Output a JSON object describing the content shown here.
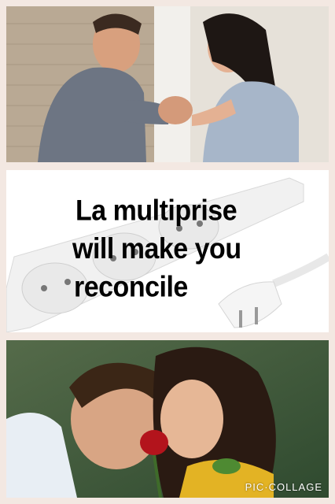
{
  "meme": {
    "caption_lines": [
      "La multiprise",
      "will make you",
      "reconcile"
    ]
  },
  "watermark": "PIC·COLLAGE",
  "colors": {
    "background": "#f3e8e2",
    "caption_text": "#000000",
    "power_strip": "#f4f4f4"
  },
  "panels": [
    {
      "name": "couple-arguing-photo"
    },
    {
      "name": "power-strip-photo"
    },
    {
      "name": "couple-reconciled-rose-photo"
    }
  ]
}
